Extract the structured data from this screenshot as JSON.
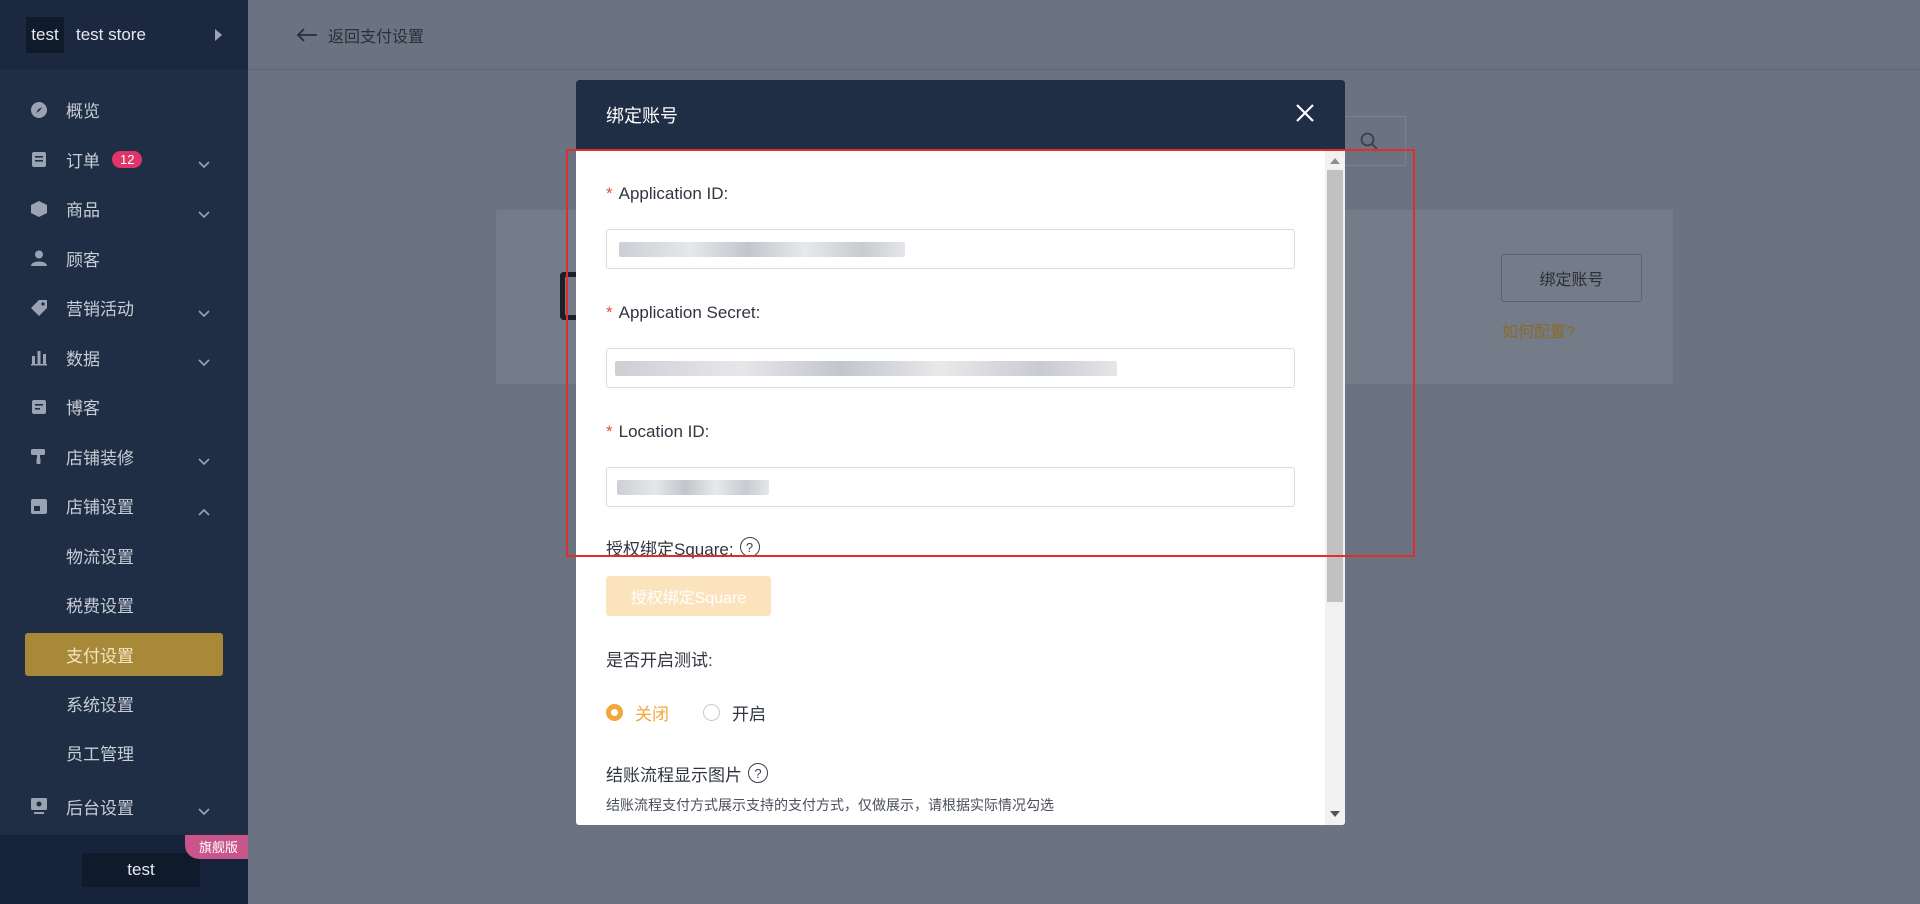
{
  "sidebar": {
    "logo": "test",
    "store_name": "test store",
    "items": [
      {
        "label": "概览",
        "icon": "dashboard-icon"
      },
      {
        "label": "订单",
        "icon": "orders-icon",
        "badge": "12",
        "expandable": true
      },
      {
        "label": "商品",
        "icon": "products-icon",
        "expandable": true
      },
      {
        "label": "顾客",
        "icon": "customer-icon"
      },
      {
        "label": "营销活动",
        "icon": "tag-icon",
        "expandable": true
      },
      {
        "label": "数据",
        "icon": "chart-icon",
        "expandable": true
      },
      {
        "label": "博客",
        "icon": "blog-icon"
      },
      {
        "label": "店铺装修",
        "icon": "brush-icon",
        "expandable": true
      },
      {
        "label": "店铺设置",
        "icon": "store-icon",
        "expanded": true
      }
    ],
    "sub_items": [
      "物流设置",
      "税费设置",
      "支付设置",
      "系统设置",
      "员工管理"
    ],
    "active_sub": "支付设置",
    "backend": {
      "label": "后台设置",
      "icon": "monitor-icon"
    },
    "footer_user": "test",
    "footer_badge": "旗舰版"
  },
  "topbar": {
    "back_label": "返回支付设置"
  },
  "background": {
    "bind_button": "绑定账号",
    "howto_link": "如何配置?"
  },
  "modal": {
    "title": "绑定账号",
    "fields": [
      {
        "label": "Application ID:",
        "required": true
      },
      {
        "label": "Application Secret:",
        "required": true
      },
      {
        "label": "Location ID:",
        "required": true
      }
    ],
    "auth_label": "授权绑定Square:",
    "auth_button": "授权绑定Square",
    "test_label": "是否开启测试:",
    "radio_off": "关闭",
    "radio_on": "开启",
    "selected": "关闭",
    "image_label": "结账流程显示图片",
    "image_hint": "结账流程支付方式展示支持的支付方式，仅做展示，请根据实际情况勾选"
  },
  "colors": {
    "accent": "#f2a73b",
    "sidebar": "#1f2d45",
    "highlight": "#e32d2d",
    "badge": "#e0356a"
  }
}
